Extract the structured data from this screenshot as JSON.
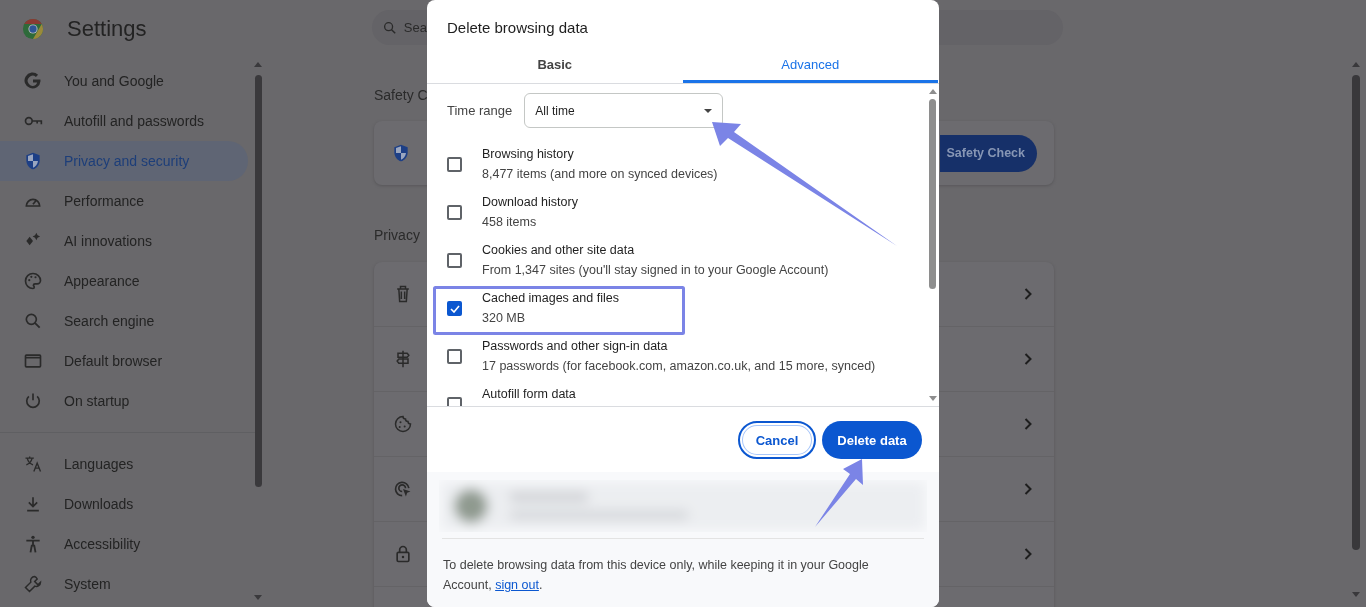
{
  "app": {
    "title": "Settings"
  },
  "sidebar": {
    "groups": [
      [
        {
          "label": "You and Google",
          "selected": false
        },
        {
          "label": "Autofill and passwords",
          "selected": false
        },
        {
          "label": "Privacy and security",
          "selected": true
        },
        {
          "label": "Performance",
          "selected": false
        },
        {
          "label": "AI innovations",
          "selected": false
        },
        {
          "label": "Appearance",
          "selected": false
        },
        {
          "label": "Search engine",
          "selected": false
        },
        {
          "label": "Default browser",
          "selected": false
        },
        {
          "label": "On startup",
          "selected": false
        }
      ],
      [
        {
          "label": "Languages",
          "selected": false
        },
        {
          "label": "Downloads",
          "selected": false
        },
        {
          "label": "Accessibility",
          "selected": false
        },
        {
          "label": "System",
          "selected": false
        }
      ]
    ]
  },
  "search": {
    "placeholder": "Sea"
  },
  "sections": [
    {
      "heading": "Safety C",
      "button": "Safety Check"
    },
    {
      "heading": "Privacy"
    }
  ],
  "dialog": {
    "title": "Delete browsing data",
    "tabs": [
      {
        "label": "Basic",
        "selected": false
      },
      {
        "label": "Advanced",
        "selected": true
      }
    ],
    "time_range": {
      "label": "Time range",
      "value": "All time"
    },
    "options": [
      {
        "label": "Browsing history",
        "detail": "8,477 items (and more on synced devices)",
        "checked": false
      },
      {
        "label": "Download history",
        "detail": "458 items",
        "checked": false
      },
      {
        "label": "Cookies and other site data",
        "detail": "From 1,347 sites (you'll stay signed in to your Google Account)",
        "checked": false
      },
      {
        "label": "Cached images and files",
        "detail": "320 MB",
        "checked": true
      },
      {
        "label": "Passwords and other sign-in data",
        "detail": "17 passwords (for facebook.com, amazon.co.uk, and 15 more, synced)",
        "checked": false
      },
      {
        "label": "Autofill form data",
        "checked": false
      }
    ],
    "buttons": [
      {
        "label": "Cancel",
        "kind": "outline"
      },
      {
        "label": "Delete data",
        "kind": "primary"
      }
    ],
    "note": {
      "before": "To delete browsing data from this device only, while keeping it in your Google Account, ",
      "link": "sign out",
      "after": "."
    }
  }
}
